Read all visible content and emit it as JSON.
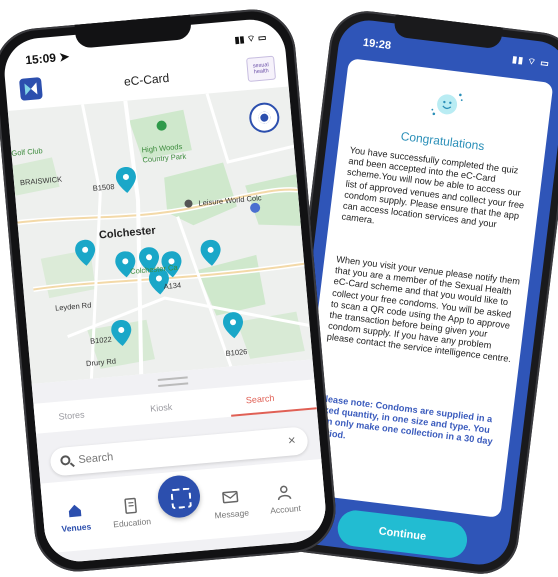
{
  "back_phone": {
    "status_time": "19:28",
    "status_icons": "▮▮ ⌔ ▭",
    "title": "Congratulations",
    "paragraph1": "You have successfully completed the quiz and been accepted into the eC-Card scheme.You will now be able to access our list of approved venues and collect your free condom supply. Please ensure that the app can access location services and your camera.",
    "paragraph2": "When you visit your venue please notify them that you are a member of the Sexual Health eC-Card scheme and that you would like to collect your free condoms. You will be asked to scan a QR code using the App to approve the transaction before being given your condom supply. If you have any problem please contact the service intelligence centre.",
    "paragraph3": "Please note: Condoms are supplied in a fixed quantity, in one size and type. You can only make one collection in a 30 day period.",
    "continue_label": "Continue",
    "accent_color": "#2f55b8",
    "button_color": "#22bcd2"
  },
  "front_phone": {
    "status_time": "15:09 ➤",
    "status_icons": "▮▮ ⌔ ▭",
    "app_title": "eC-Card",
    "partner_logo_text": "sexual health",
    "map_labels": {
      "golf_club": "Golf Club",
      "braiswick": "BRAISWICK",
      "high_woods": "High Woods",
      "country_park": "Country Park",
      "leisure_world": "Leisure World Colc",
      "colchester": "Colchester",
      "colchester_castle": "Colchester Ca",
      "a134": "A134",
      "layden_rd": "Leyden Rd",
      "b1022": "B1022",
      "drury_rd": "Drury Rd",
      "b1026": "B1026",
      "b1508": "B1508"
    },
    "tabs": [
      {
        "label": "Stores",
        "active": false
      },
      {
        "label": "Kiosk",
        "active": false
      },
      {
        "label": "Search",
        "active": true
      }
    ],
    "search": {
      "placeholder": "Search",
      "value": "",
      "clear": "×"
    },
    "nav": [
      {
        "label": "Venues",
        "icon": "home-icon",
        "active": true
      },
      {
        "label": "Education",
        "icon": "book-icon",
        "active": false
      },
      {
        "label": "Message",
        "icon": "mail-icon",
        "active": false
      },
      {
        "label": "Account",
        "icon": "user-icon",
        "active": false
      }
    ],
    "brand_color": "#2c4fae",
    "pin_color": "#1aa7c8",
    "tab_accent": "#e06055"
  }
}
